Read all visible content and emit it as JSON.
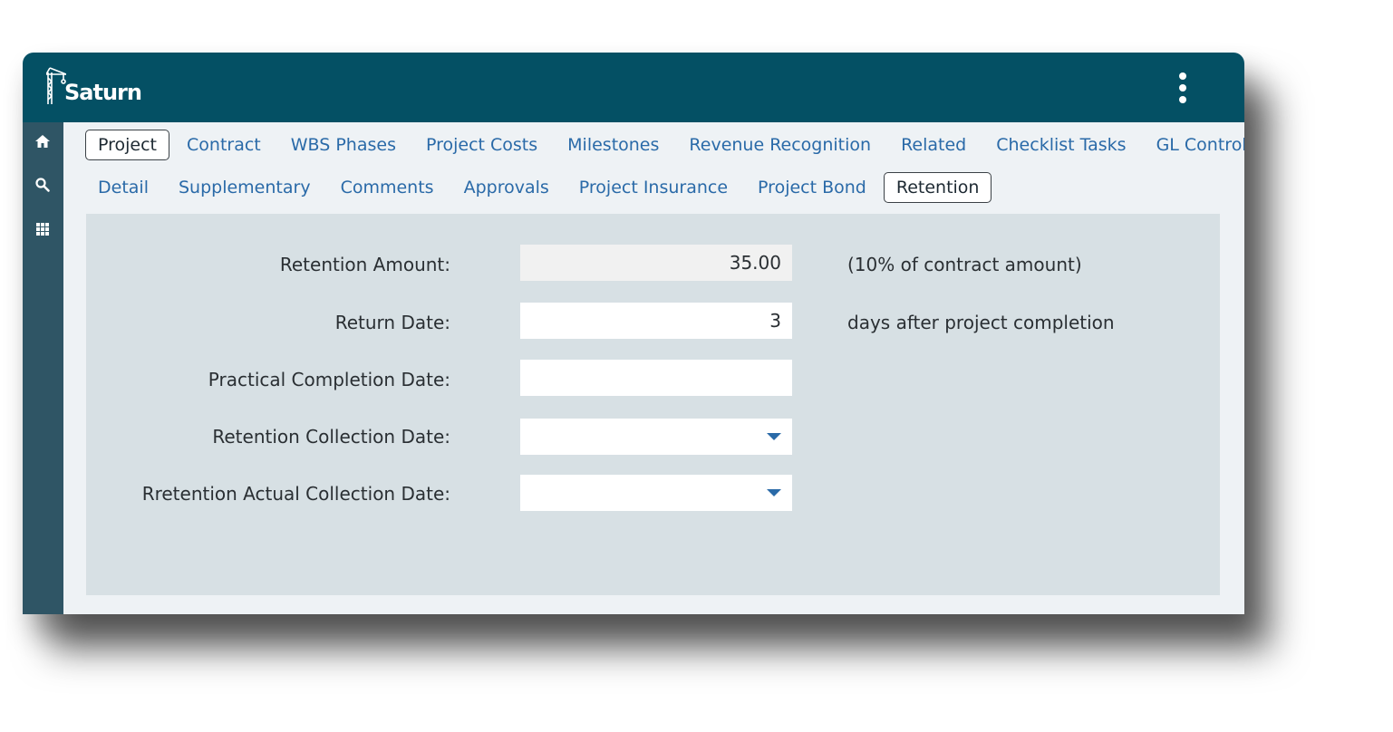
{
  "app": {
    "brand": "Saturn",
    "menu_icon": "kebab-menu-icon"
  },
  "sidebar": {
    "items": [
      {
        "icon": "home-icon"
      },
      {
        "icon": "search-icon"
      },
      {
        "icon": "apps-grid-icon"
      }
    ]
  },
  "tabs": {
    "row1": [
      {
        "label": "Project",
        "active": true
      },
      {
        "label": "Contract"
      },
      {
        "label": "WBS Phases"
      },
      {
        "label": "Project Costs"
      },
      {
        "label": "Milestones"
      },
      {
        "label": "Revenue Recognition"
      },
      {
        "label": "Related"
      },
      {
        "label": "Checklist Tasks"
      },
      {
        "label": "GL Control"
      }
    ],
    "row2": [
      {
        "label": "Detail"
      },
      {
        "label": "Supplementary"
      },
      {
        "label": "Comments"
      },
      {
        "label": "Approvals"
      },
      {
        "label": "Project Insurance"
      },
      {
        "label": "Project Bond"
      },
      {
        "label": "Retention",
        "active": true
      }
    ]
  },
  "form": {
    "retention_amount": {
      "label": "Retention Amount:",
      "value": "35.00",
      "note": "(10% of contract  amount)"
    },
    "return_date": {
      "label": "Return Date:",
      "value": "3",
      "note": "days after project completion"
    },
    "practical_completion_date": {
      "label": "Practical Completion Date:",
      "value": ""
    },
    "retention_collection_date": {
      "label": "Retention Collection Date:",
      "value": ""
    },
    "retention_actual_collection_date": {
      "label": "Rretention Actual Collection Date:",
      "value": ""
    }
  },
  "colors": {
    "header": "#045064",
    "sidebar": "#2f5565",
    "tab_link": "#2a6aa8",
    "panel": "#d7e0e4"
  }
}
